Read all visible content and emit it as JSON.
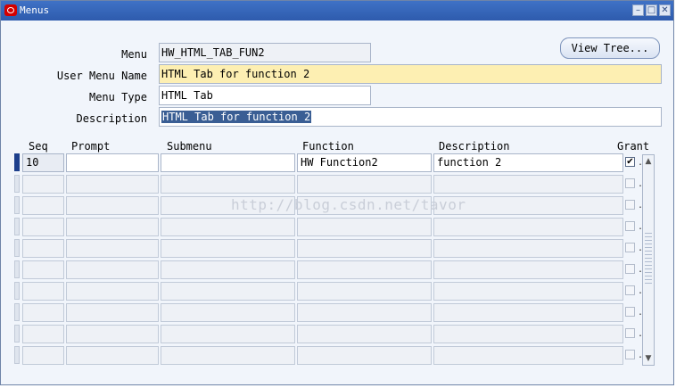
{
  "window": {
    "title": "Menus"
  },
  "form": {
    "menu_label": "Menu",
    "menu_value": "HW_HTML_TAB_FUN2",
    "user_menu_name_label": "User Menu Name",
    "user_menu_name_value": "HTML Tab for function 2",
    "menu_type_label": "Menu Type",
    "menu_type_value": "HTML Tab",
    "description_label": "Description",
    "description_value": "HTML Tab for function 2",
    "view_tree_label": "View Tree..."
  },
  "table": {
    "headers": {
      "seq": "Seq",
      "prompt": "Prompt",
      "submenu": "Submenu",
      "function": "Function",
      "description": "Description",
      "grant": "Grant"
    },
    "rows": [
      {
        "seq": "10",
        "prompt": "",
        "submenu": "",
        "function": "HW Function2",
        "description": "function 2",
        "grant": true
      },
      {
        "seq": "",
        "prompt": "",
        "submenu": "",
        "function": "",
        "description": "",
        "grant": false
      },
      {
        "seq": "",
        "prompt": "",
        "submenu": "",
        "function": "",
        "description": "",
        "grant": false
      },
      {
        "seq": "",
        "prompt": "",
        "submenu": "",
        "function": "",
        "description": "",
        "grant": false
      },
      {
        "seq": "",
        "prompt": "",
        "submenu": "",
        "function": "",
        "description": "",
        "grant": false
      },
      {
        "seq": "",
        "prompt": "",
        "submenu": "",
        "function": "",
        "description": "",
        "grant": false
      },
      {
        "seq": "",
        "prompt": "",
        "submenu": "",
        "function": "",
        "description": "",
        "grant": false
      },
      {
        "seq": "",
        "prompt": "",
        "submenu": "",
        "function": "",
        "description": "",
        "grant": false
      },
      {
        "seq": "",
        "prompt": "",
        "submenu": "",
        "function": "",
        "description": "",
        "grant": false
      },
      {
        "seq": "",
        "prompt": "",
        "submenu": "",
        "function": "",
        "description": "",
        "grant": false
      }
    ]
  },
  "watermark": "http://blog.csdn.net/tavor",
  "colors": {
    "titlebar": "#3f72c6",
    "required_field": "#fdefb2",
    "current_row_marker": "#1d3f8c"
  }
}
